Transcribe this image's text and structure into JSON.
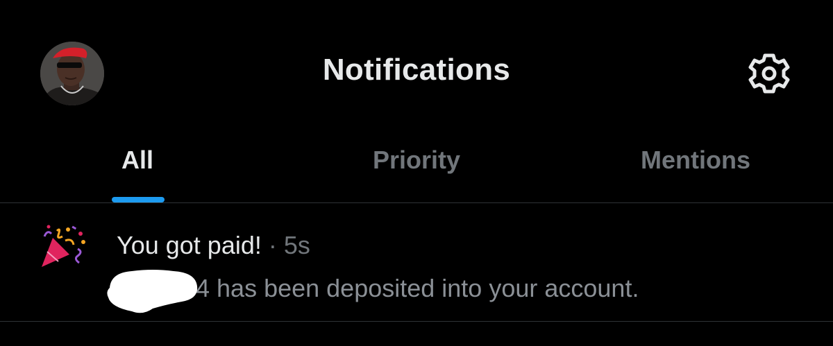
{
  "header": {
    "title": "Notifications",
    "avatar_icon": "user-avatar",
    "settings_icon": "gear-icon"
  },
  "tabs": [
    {
      "label": "All",
      "active": true
    },
    {
      "label": "Priority",
      "active": false
    },
    {
      "label": "Mentions",
      "active": false
    }
  ],
  "notifications": [
    {
      "icon": "party-popper-icon",
      "title": "You got paid!",
      "separator": "·",
      "time": "5s",
      "body": "4 has been deposited into your account."
    }
  ],
  "colors": {
    "background": "#000000",
    "text_primary": "#e7e9ea",
    "text_secondary": "#71767b",
    "accent": "#1d9bf0",
    "divider": "#2f3336"
  }
}
